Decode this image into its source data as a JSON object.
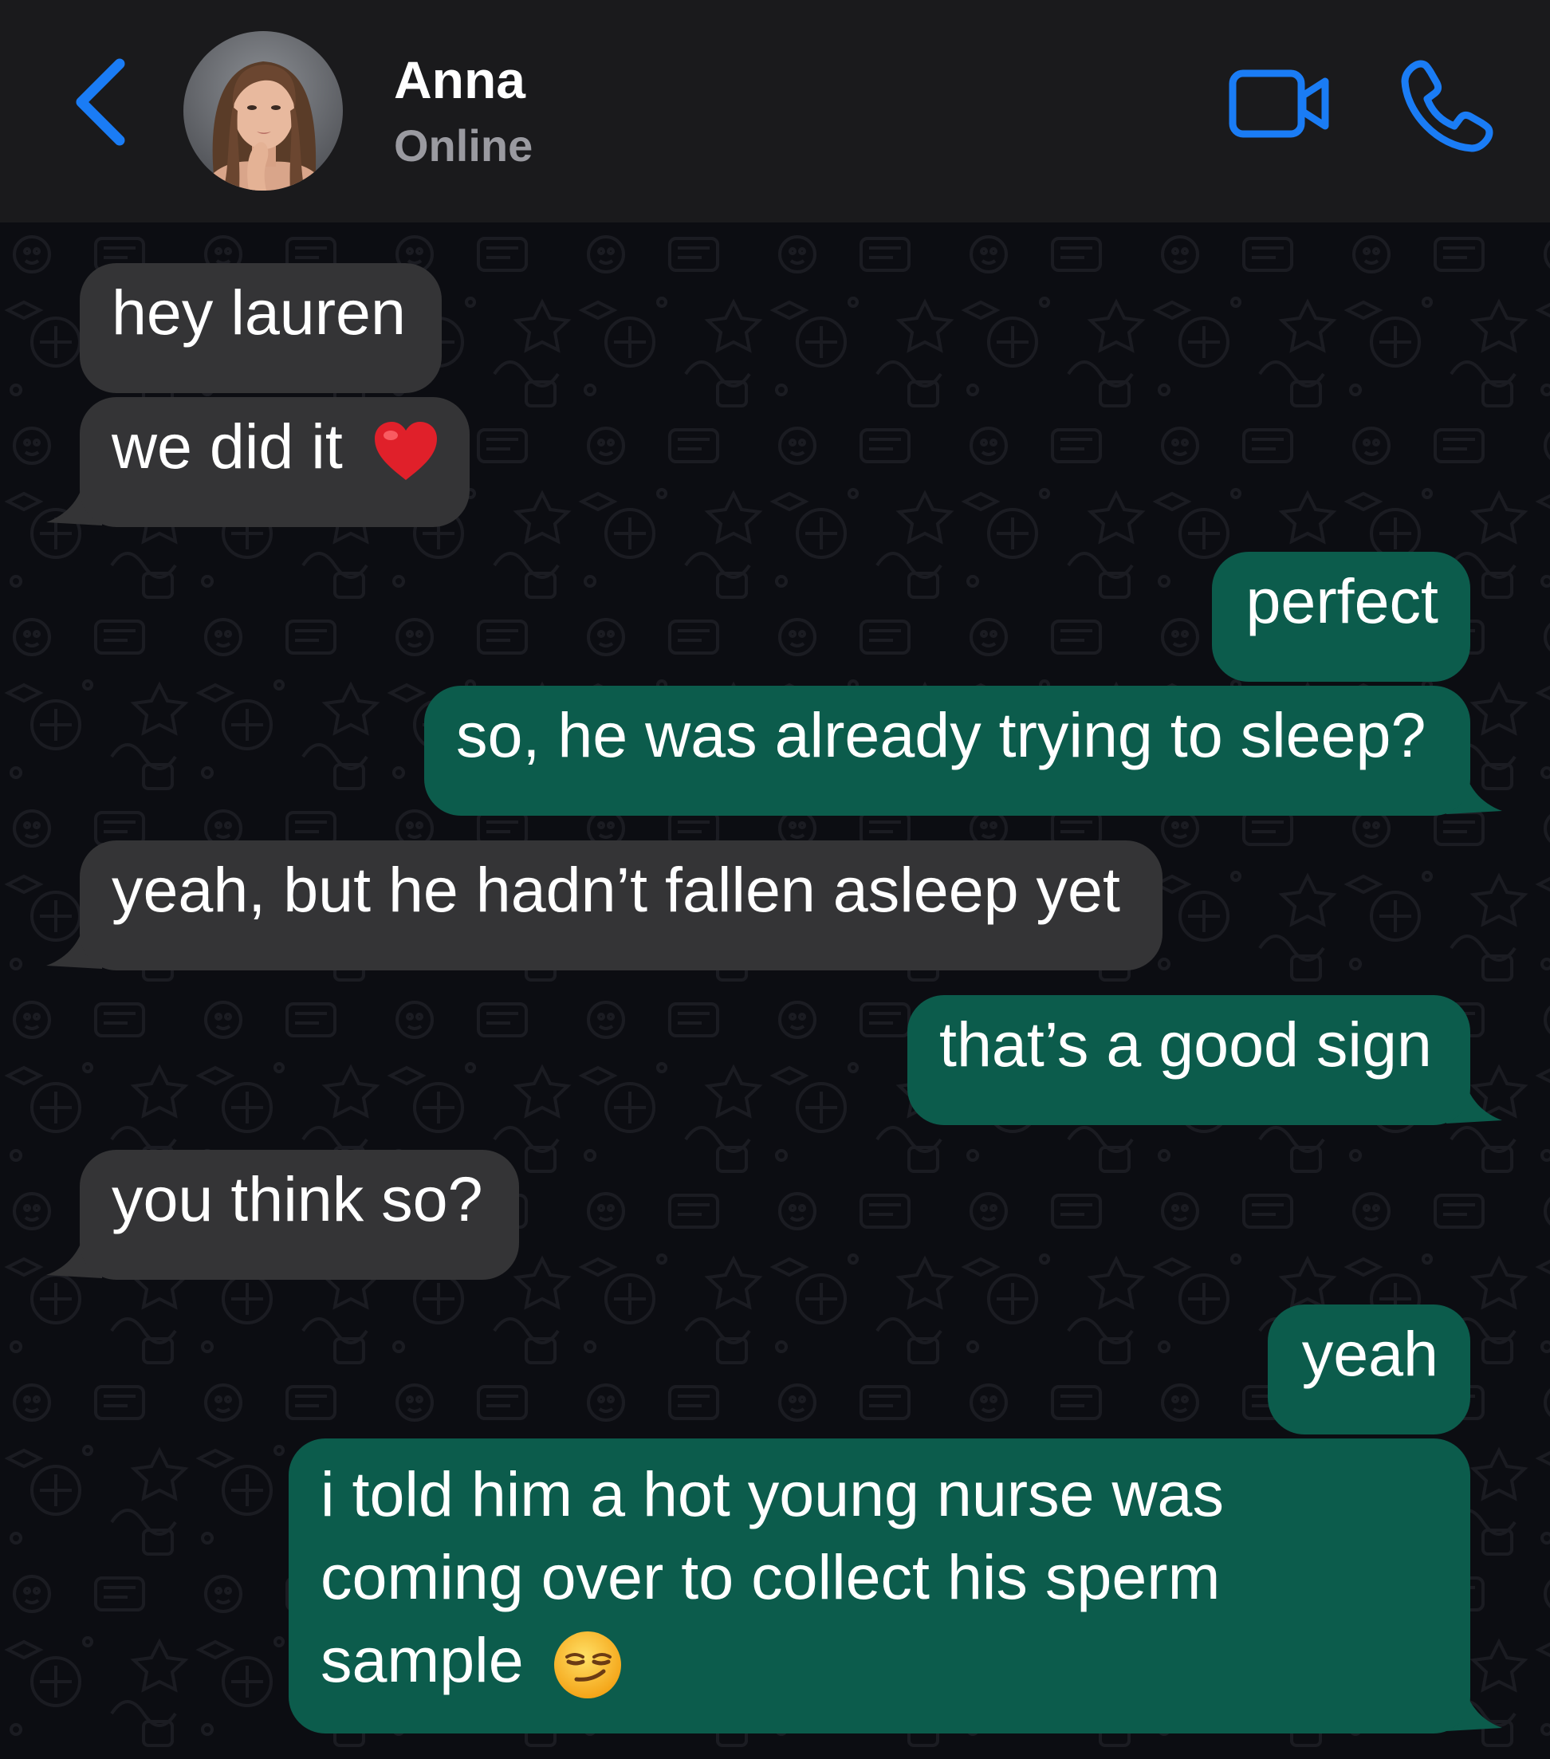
{
  "header": {
    "contact_name": "Anna",
    "status": "Online",
    "back_icon": "chevron-left-icon",
    "video_icon": "video-camera-icon",
    "call_icon": "phone-icon",
    "accent_color": "#1a7cf5"
  },
  "colors": {
    "header_bg": "#1a1a1c",
    "chat_bg": "#0c0d12",
    "incoming_bubble": "#343436",
    "outgoing_bubble": "#0c5c4c",
    "text": "#ffffff",
    "status_text": "#9a9aa0"
  },
  "messages": [
    {
      "direction": "incoming",
      "text": "hey lauren"
    },
    {
      "direction": "incoming",
      "text": "we did it",
      "emoji": "red-heart"
    },
    {
      "direction": "outgoing",
      "text": "perfect"
    },
    {
      "direction": "outgoing",
      "text": "so, he was already trying to sleep?"
    },
    {
      "direction": "incoming",
      "text": "yeah, but he hadn’t fallen asleep yet"
    },
    {
      "direction": "outgoing",
      "text": "that’s a good sign"
    },
    {
      "direction": "incoming",
      "text": "you think so?"
    },
    {
      "direction": "outgoing",
      "text": "yeah"
    },
    {
      "direction": "outgoing",
      "text": "i told him a hot young nurse was coming over to collect his sperm sample",
      "emoji": "smirking-face"
    }
  ]
}
